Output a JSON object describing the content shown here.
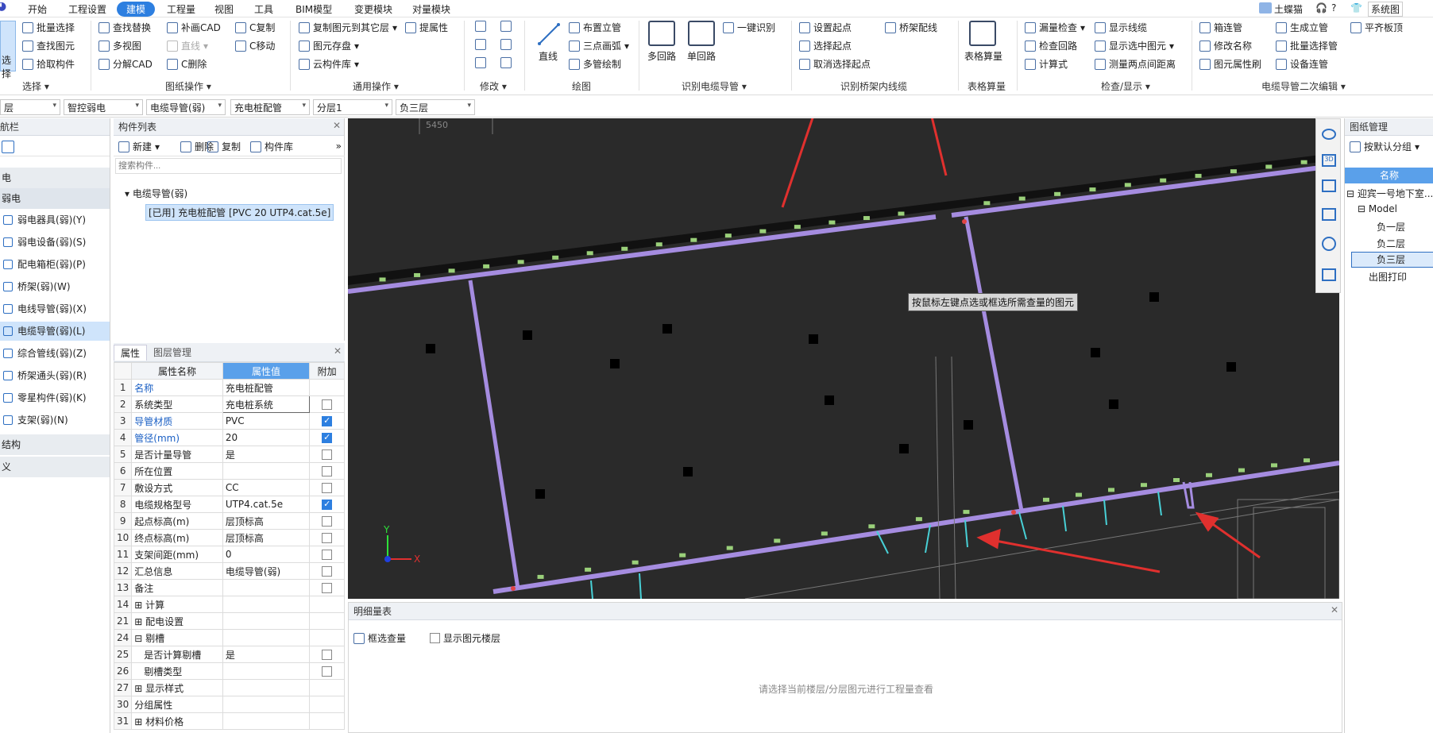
{
  "menu": {
    "items": [
      "开始",
      "工程设置",
      "建模",
      "工程量",
      "视图",
      "工具",
      "BIM模型",
      "变更模块",
      "对量模块"
    ],
    "active_index": 2,
    "user": "土蝶猫",
    "system": "系统图"
  },
  "ribbon": {
    "select": {
      "big": "选择",
      "batch": "批量选择",
      "find": "查找图元",
      "pick": "拾取构件",
      "group": "选择"
    },
    "drawing_ops": {
      "find_replace": "查找替换",
      "multi_view": "多视图",
      "decompose_cad": "分解CAD",
      "repair_cad": "补画CAD",
      "line": "直线",
      "c_copy": "C复制",
      "c_move": "C移动",
      "c_delete": "C删除",
      "group": "图纸操作"
    },
    "general_ops": {
      "copy_floor": "复制图元到其它层",
      "elem_disk": "图元存盘",
      "cloud_lib": "云构件库",
      "attr": "提属性",
      "group": "通用操作"
    },
    "modify": {
      "group": "修改"
    },
    "draw": {
      "line": "直线",
      "riser": "布置立管",
      "arc3": "三点画弧",
      "multi_pipe": "多管绘制",
      "group": "绘图"
    },
    "recognize_cable": {
      "multi_loop": "多回路",
      "single_loop": "单回路",
      "one_click": "一键识别",
      "group": "识别电缆导管"
    },
    "recognize_tray": {
      "set_start": "设置起点",
      "sel_start": "选择起点",
      "cancel_start": "取消选择起点",
      "tray_wire": "桥架配线",
      "group": "识别桥架内线缆"
    },
    "table_calc": {
      "label": "表格算量",
      "group": "表格算量"
    },
    "check_show": {
      "leak_check": "漏量检查",
      "check_loop": "检查回路",
      "calc_formula": "计算式",
      "show_wire": "显示线缆",
      "show_selected": "显示选中图元",
      "measure_dist": "测量两点间距离",
      "group": "检查/显示"
    },
    "secondary": {
      "box_pipe": "箱连管",
      "rename": "修改名称",
      "elem_attr": "图元属性刷",
      "gen_riser": "生成立管",
      "batch_pipe": "批量选择管",
      "device_pipe": "设备连管",
      "flat_tray": "平齐板顶",
      "group": "电缆导管二次编辑"
    }
  },
  "filters": [
    "层",
    "智控弱电",
    "电缆导管(弱)",
    "充电桩配管",
    "分层1",
    "负三层"
  ],
  "nav": {
    "title": "航栏",
    "section_top": "电",
    "section": "弱电",
    "items": [
      "弱电器具(弱)(Y)",
      "弱电设备(弱)(S)",
      "配电箱柜(弱)(P)",
      "桥架(弱)(W)",
      "电线导管(弱)(X)",
      "电缆导管(弱)(L)",
      "综合管线(弱)(Z)",
      "桥架通头(弱)(R)",
      "零星构件(弱)(K)",
      "支架(弱)(N)"
    ],
    "selected_index": 5,
    "section_struct": "结构",
    "section_custom": "义"
  },
  "component_list": {
    "title": "构件列表",
    "new": "新建",
    "delete": "删除",
    "copy": "复制",
    "library": "构件库",
    "search_placeholder": "搜索构件...",
    "tree_root": "电缆导管(弱)",
    "tree_item": "[已用] 充电桩配管 [PVC 20 UTP4.cat.5e]"
  },
  "properties": {
    "tab_props": "属性",
    "tab_layers": "图层管理",
    "col_name": "属性名称",
    "col_value": "属性值",
    "col_extra": "附加",
    "rows": [
      {
        "n": "1",
        "k": "名称",
        "v": "充电桩配管",
        "blue": true,
        "cb": null
      },
      {
        "n": "2",
        "k": "系统类型",
        "v": "充电桩系统",
        "blue": false,
        "cb": false
      },
      {
        "n": "3",
        "k": "导管材质",
        "v": "PVC",
        "blue": true,
        "cb": true
      },
      {
        "n": "4",
        "k": "管径(mm)",
        "v": "20",
        "blue": true,
        "cb": true
      },
      {
        "n": "5",
        "k": "是否计量导管",
        "v": "是",
        "blue": false,
        "cb": false
      },
      {
        "n": "6",
        "k": "所在位置",
        "v": "",
        "blue": false,
        "cb": false
      },
      {
        "n": "7",
        "k": "敷设方式",
        "v": "CC",
        "blue": false,
        "cb": false
      },
      {
        "n": "8",
        "k": "电缆规格型号",
        "v": "UTP4.cat.5e",
        "blue": false,
        "cb": true
      },
      {
        "n": "9",
        "k": "起点标高(m)",
        "v": "层顶标高",
        "blue": false,
        "cb": false
      },
      {
        "n": "10",
        "k": "终点标高(m)",
        "v": "层顶标高",
        "blue": false,
        "cb": false
      },
      {
        "n": "11",
        "k": "支架间距(mm)",
        "v": "0",
        "blue": false,
        "cb": false
      },
      {
        "n": "12",
        "k": "汇总信息",
        "v": "电缆导管(弱)",
        "blue": false,
        "cb": false
      },
      {
        "n": "13",
        "k": "备注",
        "v": "",
        "blue": false,
        "cb": false
      },
      {
        "n": "14",
        "k": "⊞ 计算",
        "v": "",
        "blue": false,
        "cb": null
      },
      {
        "n": "21",
        "k": "⊞ 配电设置",
        "v": "",
        "blue": false,
        "cb": null
      },
      {
        "n": "24",
        "k": "⊟ 剔槽",
        "v": "",
        "blue": false,
        "cb": null
      },
      {
        "n": "25",
        "k": "　是否计算剔槽",
        "v": "是",
        "blue": false,
        "cb": false
      },
      {
        "n": "26",
        "k": "　剔槽类型",
        "v": "",
        "blue": false,
        "cb": false
      },
      {
        "n": "27",
        "k": "⊞ 显示样式",
        "v": "",
        "blue": false,
        "cb": null
      },
      {
        "n": "30",
        "k": "分组属性",
        "v": "",
        "blue": false,
        "cb": null
      },
      {
        "n": "31",
        "k": "⊞ 材料价格",
        "v": "",
        "blue": false,
        "cb": null
      }
    ]
  },
  "canvas": {
    "tooltip": "按鼠标左键点选或框选所需查量的图元",
    "dim_label": "5450",
    "axis_y": "Y",
    "axis_x": "X"
  },
  "drawing_mgmt": {
    "title": "图纸管理",
    "group_btn": "按默认分组",
    "col": "名称",
    "tree": [
      "迎宾一号地下室...",
      "Model",
      "负一层",
      "负二层",
      "负三层",
      "出图打印"
    ],
    "selected_index": 4
  },
  "detail_table": {
    "title": "明细量表",
    "frame_query": "框选查量",
    "show_floor": "显示图元楼层",
    "empty_hint": "请选择当前楼层/分层图元进行工程量查看"
  }
}
